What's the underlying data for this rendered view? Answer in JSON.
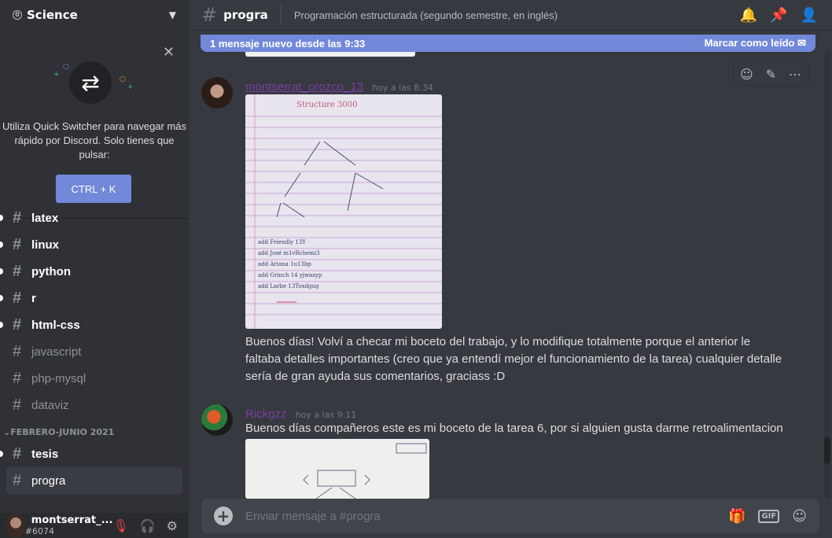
{
  "server": {
    "name": "Science"
  },
  "quick_switcher": {
    "text": "Utiliza Quick Switcher para navegar más rápido por Discord. Solo tienes que pulsar:",
    "shortcut": "CTRL + K"
  },
  "channels": [
    {
      "name": "latex",
      "state": "unread"
    },
    {
      "name": "linux",
      "state": "unread"
    },
    {
      "name": "python",
      "state": "unread"
    },
    {
      "name": "r",
      "state": "unread"
    },
    {
      "name": "html-css",
      "state": "unread"
    },
    {
      "name": "javascript",
      "state": "muted"
    },
    {
      "name": "php-mysql",
      "state": "muted"
    },
    {
      "name": "dataviz",
      "state": "muted"
    }
  ],
  "category": {
    "name": "FEBRERO-JUNIO 2021"
  },
  "category_channels": [
    {
      "name": "tesis",
      "state": "unread"
    },
    {
      "name": "progra",
      "state": "active"
    }
  ],
  "user": {
    "name": "montserrat_...",
    "tag": "#6074"
  },
  "channel_header": {
    "name": "progra",
    "topic": "Programación estructurada (segundo semestre, en inglés)"
  },
  "new_messages_bar": {
    "text": "1 mensaje nuevo desde las 9:33",
    "action": "Marcar como leído"
  },
  "messages": [
    {
      "author": "montserrat_orozco_13",
      "time": "hoy a las 8:34",
      "attachment": {
        "title": "Structure 3000",
        "lines": [
          "add Friendly 13Y",
          "add José m1vRchemi3",
          "add Ariana 1u13bp",
          "add Grinch 14 yjwazyp",
          "add Larbe 13Toxdgug"
        ]
      },
      "text": "Buenos días! Volví a checar mi boceto del trabajo, y lo modifique totalmente porque el anterior le faltaba detalles importantes (creo que ya entendí mejor el funcionamiento de la tarea) cualquier detalle sería de gran ayuda sus comentarios, graciass :D"
    },
    {
      "author": "Rickgzz",
      "time": "hoy a las 9:11",
      "text": "Buenos días compañeros este es mi boceto de la tarea 6, por si alguien gusta darme retroalimentacion"
    }
  ],
  "composer": {
    "placeholder": "Enviar mensaje a #progra",
    "gif_label": "GIF"
  },
  "colors": {
    "accent": "#7289da",
    "author1": "#7a3fa0",
    "author2": "#7a3fa0"
  }
}
